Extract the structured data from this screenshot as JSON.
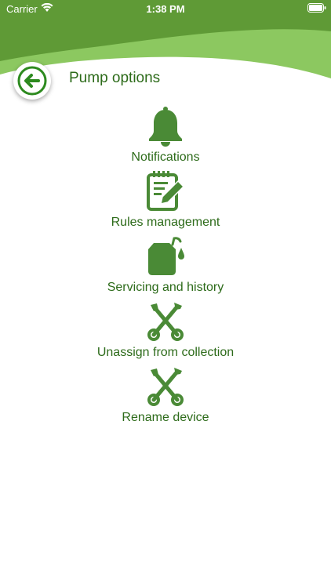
{
  "status_bar": {
    "carrier": "Carrier",
    "time": "1:38 PM",
    "wifi_icon": "wifi-icon",
    "battery_icon": "battery-icon"
  },
  "header": {
    "title": "Pump options",
    "back_icon": "arrow-left-icon"
  },
  "colors": {
    "header_green_dark": "#5f9a36",
    "header_green_light": "#8cc860",
    "accent_green": "#2d6b1a",
    "icon_green": "#4a8a36"
  },
  "menu": {
    "items": [
      {
        "label": "Notifications",
        "icon": "bell-icon"
      },
      {
        "label": "Rules management",
        "icon": "notepad-edit-icon"
      },
      {
        "label": "Servicing and history",
        "icon": "oil-can-icon"
      },
      {
        "label": "Unassign from collection",
        "icon": "tools-icon"
      },
      {
        "label": "Rename device",
        "icon": "tools-icon"
      }
    ]
  }
}
